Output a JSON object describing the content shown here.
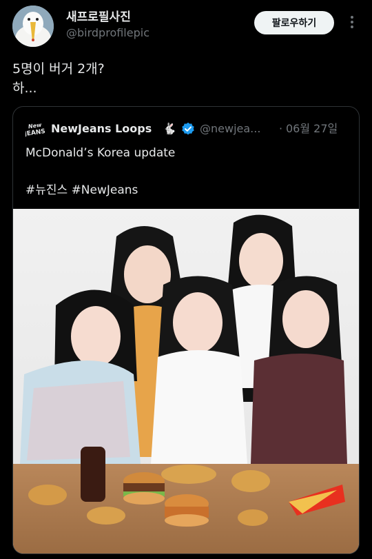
{
  "author": {
    "display_name": "새프로필사진",
    "handle": "@birdprofilepic",
    "follow_label": "팔로우하기"
  },
  "post": {
    "lines": [
      "5명이 버거 2개?",
      "하..."
    ]
  },
  "quoted": {
    "logo_text": "NewJeans",
    "display_name": "NewJeans Loops",
    "emoji": "🐇",
    "handle": "@newjea...",
    "separator": "·",
    "date": "06월 27일",
    "body_lines": [
      "McDonald’s Korea update",
      "",
      "#뉴진스 #NewJeans"
    ],
    "image_alt": "NewJeans members with McDonald's burgers, nuggets, fries and cola"
  },
  "colors": {
    "background": "#000000",
    "text_primary": "#e7e9ea",
    "text_secondary": "#71767b",
    "verified": "#1d9bf0",
    "follow_bg": "#eff3f4"
  },
  "icons": [
    "seagull-avatar",
    "newjeans-logo-icon",
    "rabbit-emoji",
    "verified-badge-icon",
    "more-options-icon"
  ]
}
